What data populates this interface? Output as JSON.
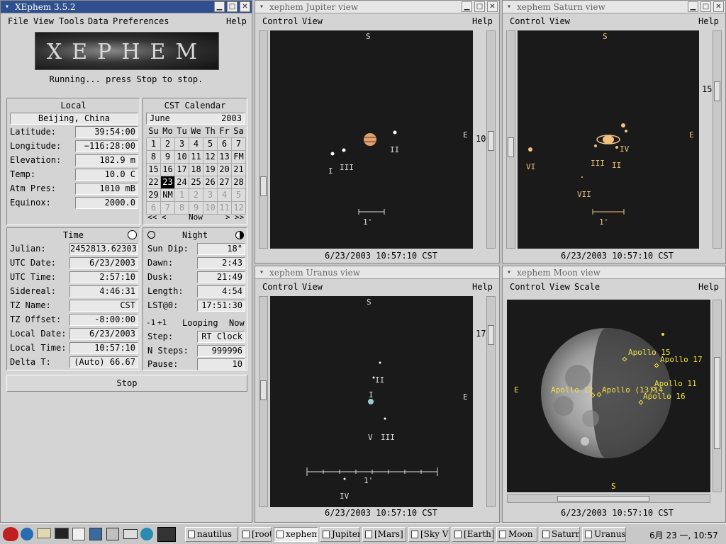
{
  "main": {
    "title": "XEphem 3.5.2",
    "menu": [
      "File",
      "View",
      "Tools",
      "Data",
      "Preferences"
    ],
    "help": "Help",
    "logo_text": "XEPHEM",
    "status": "Running... press Stop to stop.",
    "local": {
      "header": "Local",
      "location": "Beijing, China",
      "rows": [
        {
          "label": "Latitude:",
          "value": "39:54:00"
        },
        {
          "label": "Longitude:",
          "value": "−116:28:00"
        },
        {
          "label": "Elevation:",
          "value": "182.9 m"
        },
        {
          "label": "Temp:",
          "value": "10.0 C"
        },
        {
          "label": "Atm Pres:",
          "value": "1010 mB"
        },
        {
          "label": "Equinox:",
          "value": "2000.0"
        }
      ]
    },
    "calendar": {
      "header": "CST Calendar",
      "month": "June",
      "year": "2003",
      "weekdays": [
        "Su",
        "Mo",
        "Tu",
        "We",
        "Th",
        "Fr",
        "Sa"
      ],
      "weeks": [
        [
          "1",
          "2",
          "3",
          "4",
          "5",
          "6",
          "7"
        ],
        [
          "8",
          "9",
          "10",
          "11",
          "12",
          "13",
          "FM"
        ],
        [
          "15",
          "16",
          "17",
          "18",
          "19",
          "20",
          "21"
        ],
        [
          "22",
          "23",
          "24",
          "25",
          "26",
          "27",
          "28"
        ],
        [
          "29",
          "NM",
          "1",
          "2",
          "3",
          "4",
          "5"
        ],
        [
          "6",
          "7",
          "8",
          "9",
          "10",
          "11",
          "12"
        ]
      ],
      "now": "Now",
      "nav": [
        "<<",
        "<",
        ">",
        ">>"
      ]
    },
    "time": {
      "header": "Time",
      "rows": [
        {
          "label": "Julian:",
          "value": "2452813.62303"
        },
        {
          "label": "UTC Date:",
          "value": "6/23/2003"
        },
        {
          "label": "UTC Time:",
          "value": "2:57:10"
        },
        {
          "label": "Sidereal:",
          "value": "4:46:31"
        },
        {
          "label": "TZ Name:",
          "value": "CST"
        },
        {
          "label": "TZ Offset:",
          "value": "-8:00:00"
        },
        {
          "label": "Local Date:",
          "value": "6/23/2003"
        },
        {
          "label": "Local Time:",
          "value": "10:57:10"
        },
        {
          "label": "Delta T:",
          "value": "(Auto)  66.67"
        }
      ]
    },
    "night": {
      "header": "Night",
      "rows": [
        {
          "label": "Sun Dip:",
          "value": "18°"
        },
        {
          "label": "Dawn:",
          "value": "2:43"
        },
        {
          "label": "Dusk:",
          "value": "21:49"
        },
        {
          "label": "Length:",
          "value": "4:54"
        },
        {
          "label": "LST@0:",
          "value": "17:51:30"
        }
      ],
      "step_minus": "-1",
      "step_plus": "+1",
      "looping": "Looping",
      "now": "Now",
      "step_label": "Step:",
      "step_value": "RT Clock",
      "nsteps_label": "N Steps:",
      "nsteps_value": "999996",
      "pause_label": "Pause:",
      "pause_value": "10"
    },
    "stop": "Stop"
  },
  "jupiter": {
    "title": "xephem Jupiter view",
    "menu": [
      "Control",
      "View"
    ],
    "help": "Help",
    "north": "S",
    "east": "E",
    "scale_value": "10",
    "moons": [
      "I",
      "III",
      "II"
    ],
    "scalebar": "1'",
    "status": "6/23/2003 10:57:10 CST"
  },
  "saturn": {
    "title": "xephem Saturn view",
    "menu": [
      "Control",
      "View"
    ],
    "help": "Help",
    "north": "S",
    "east": "E",
    "scale_value": "15",
    "moons": [
      "VI",
      "III",
      "II",
      "IV",
      "VII"
    ],
    "scalebar": "1'",
    "status": "6/23/2003 10:57:10 CST"
  },
  "uranus": {
    "title": "xephem Uranus view",
    "menu": [
      "Control",
      "View"
    ],
    "help": "Help",
    "north": "S",
    "east": "E",
    "scale_value": "17",
    "moons": [
      "II",
      "I",
      "V",
      "III",
      "IV"
    ],
    "scalebar": "1'",
    "status": "6/23/2003 10:57:10 CST"
  },
  "moon": {
    "title": "xephem Moon view",
    "menu": [
      "Control",
      "View",
      "Scale"
    ],
    "help": "Help",
    "north": "S",
    "east": "E",
    "sites": [
      "Apollo 15",
      "Apollo 17",
      "Apollo 11",
      "Apollo 12",
      "Apollo (13)14",
      "Apollo 16"
    ],
    "status": "6/23/2003 10:57:10 CST"
  },
  "taskbar": {
    "tasks": [
      "nautilus",
      "[root@lc",
      "xephem",
      "Jupiter",
      "[Mars]",
      "[Sky V",
      "[Earth]",
      "Moon",
      "Saturn",
      "Uranus"
    ],
    "clock": "6月 23 一, 10:57"
  },
  "colors": {
    "titlebar_active": "#2f4f8f",
    "pane": "#1a1a1a",
    "label": "#dddddd",
    "planet_jupiter": "#e0a070",
    "saturn": "#f0c080",
    "site": "#f0e040"
  }
}
